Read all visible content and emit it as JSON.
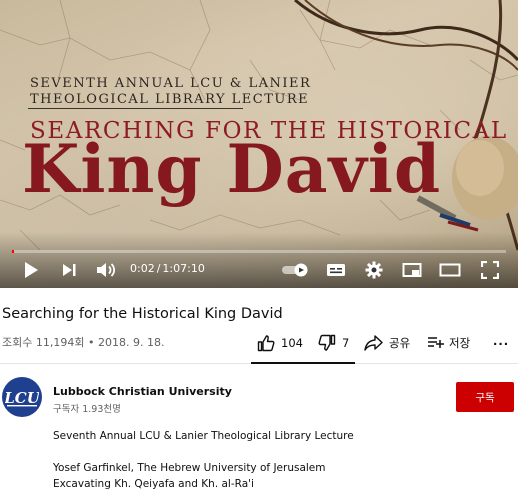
{
  "video": {
    "thumbnail": {
      "series_line1": "SEVENTH ANNUAL LCU & LANIER",
      "series_line2": "THEOLOGICAL LIBRARY LECTURE",
      "title_small": "SEARCHING FOR THE HISTORICAL",
      "title_big": "King David"
    },
    "player": {
      "current_time": "0:02",
      "separator": "/",
      "duration": "1:07:10",
      "progress_fraction": 0.0005,
      "accent_color": "#ff0000"
    },
    "title": "Searching for the Historical King David",
    "views": "조회수 11,194회",
    "meta_separator": "•",
    "date": "2018. 9. 18."
  },
  "actions": {
    "like_count": "104",
    "dislike_count": "7",
    "share_label": "공유",
    "save_label": "저장",
    "more_label": "..."
  },
  "channel": {
    "name": "Lubbock Christian University",
    "subscribers": "구독자 1.93천명",
    "subscribe_label": "구독",
    "avatar_text": "LCU",
    "brand_color": "#1f3f8f",
    "subscribe_color": "#cc0000"
  },
  "description": {
    "line1": "Seventh Annual LCU & Lanier Theological Library Lecture",
    "line2": "Yosef Garfinkel, The Hebrew University of Jerusalem",
    "line3": "Excavating Kh. Qeiyafa and Kh. al-Ra'i"
  },
  "icons": {
    "play": "play-icon",
    "next": "next-icon",
    "volume": "volume-icon",
    "autoplay": "autoplay-toggle-icon",
    "captions": "captions-icon",
    "settings": "gear-icon",
    "miniplayer": "miniplayer-icon",
    "theater": "theater-mode-icon",
    "fullscreen": "fullscreen-icon",
    "like": "thumbs-up-icon",
    "dislike": "thumbs-down-icon",
    "share": "share-icon",
    "save": "add-to-playlist-icon"
  }
}
